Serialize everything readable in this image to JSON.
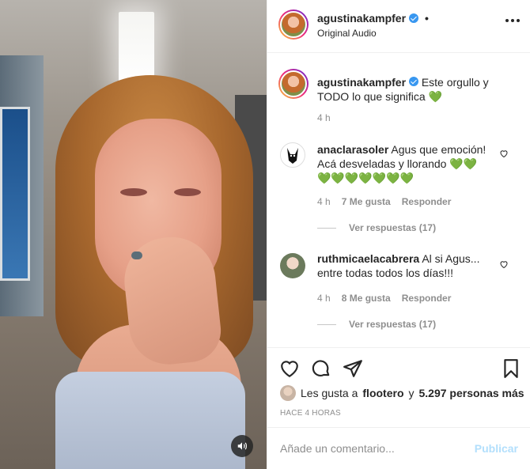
{
  "post": {
    "username": "agustinakampfer",
    "separator": "•",
    "audio": "Original Audio"
  },
  "caption": {
    "username": "agustinakampfer",
    "text": "Este orgullo y TODO lo que significa",
    "emoji": "💚",
    "time": "4 h"
  },
  "comments": [
    {
      "username": "anaclarasoler",
      "text": "Agus que emoción! Acá desveladas y llorando",
      "emoji_line1": "💚💚",
      "emoji_line2": "💚💚💚💚💚💚💚",
      "time": "4 h",
      "likes": "7 Me gusta",
      "reply": "Responder",
      "view_replies": "Ver respuestas (17)"
    },
    {
      "username": "ruthmicaelacabrera",
      "text": "Al si Agus... entre todas todos los días!!!",
      "time": "4 h",
      "likes": "8 Me gusta",
      "reply": "Responder",
      "view_replies": "Ver respuestas (17)"
    }
  ],
  "likes": {
    "prefix": "Les gusta a",
    "user": "flootero",
    "conjunction": "y",
    "others": "5.297 personas más"
  },
  "ago": "HACE 4 HORAS",
  "composer": {
    "placeholder": "Añade un comentario...",
    "post_label": "Publicar"
  },
  "colors": {
    "verified": "#3897f0",
    "green_heart": "#2ec425",
    "post_disabled": "#b2dffc",
    "muted": "#8e8e8e"
  }
}
